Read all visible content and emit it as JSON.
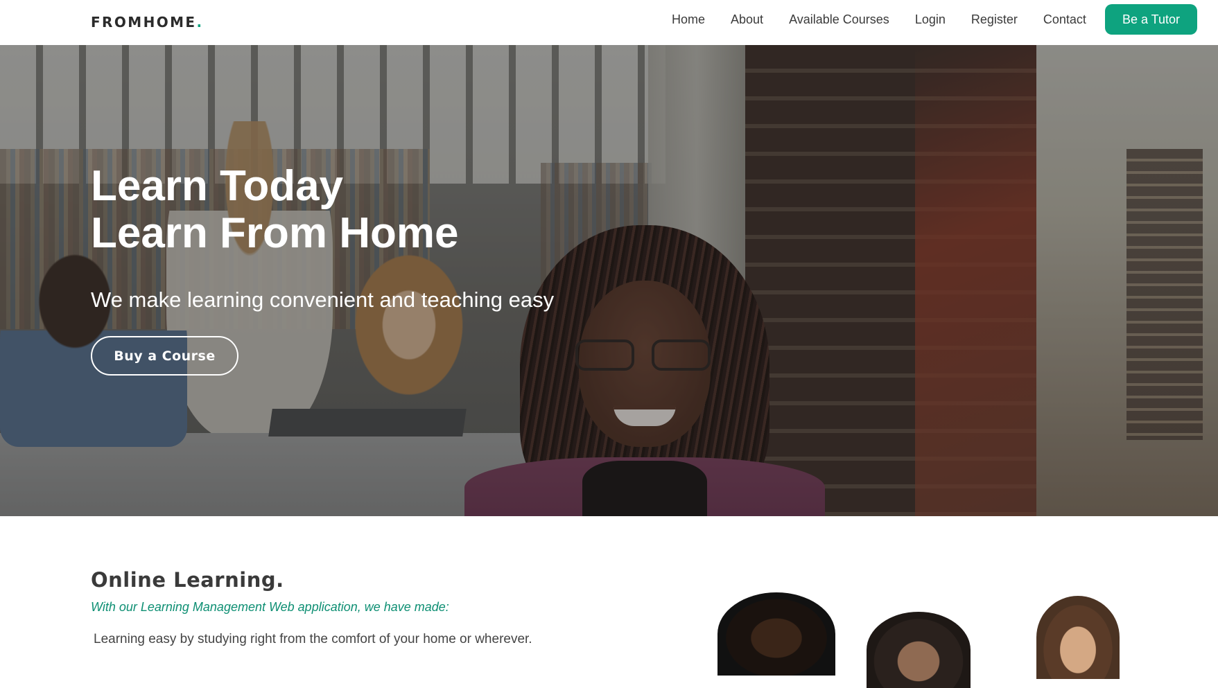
{
  "navbar": {
    "brand": "FROMHOME",
    "brand_dot": ".",
    "links": [
      "Home",
      "About",
      "Available Courses",
      "Login",
      "Register",
      "Contact"
    ],
    "cta": "Be a Tutor"
  },
  "hero": {
    "title_line1": "Learn Today",
    "title_line2": "Learn From Home",
    "subtitle": "We make learning convenient and teaching easy",
    "button": "Buy a Course"
  },
  "online_learning": {
    "title": "Online Learning.",
    "subtitle": "With our Learning Management Web application, we have made:",
    "line1": "Learning easy by studying right from the comfort of your home or wherever."
  },
  "colors": {
    "accent": "#0ea37f",
    "nav_text": "#3a3a3a",
    "hero_text": "#ffffff"
  }
}
